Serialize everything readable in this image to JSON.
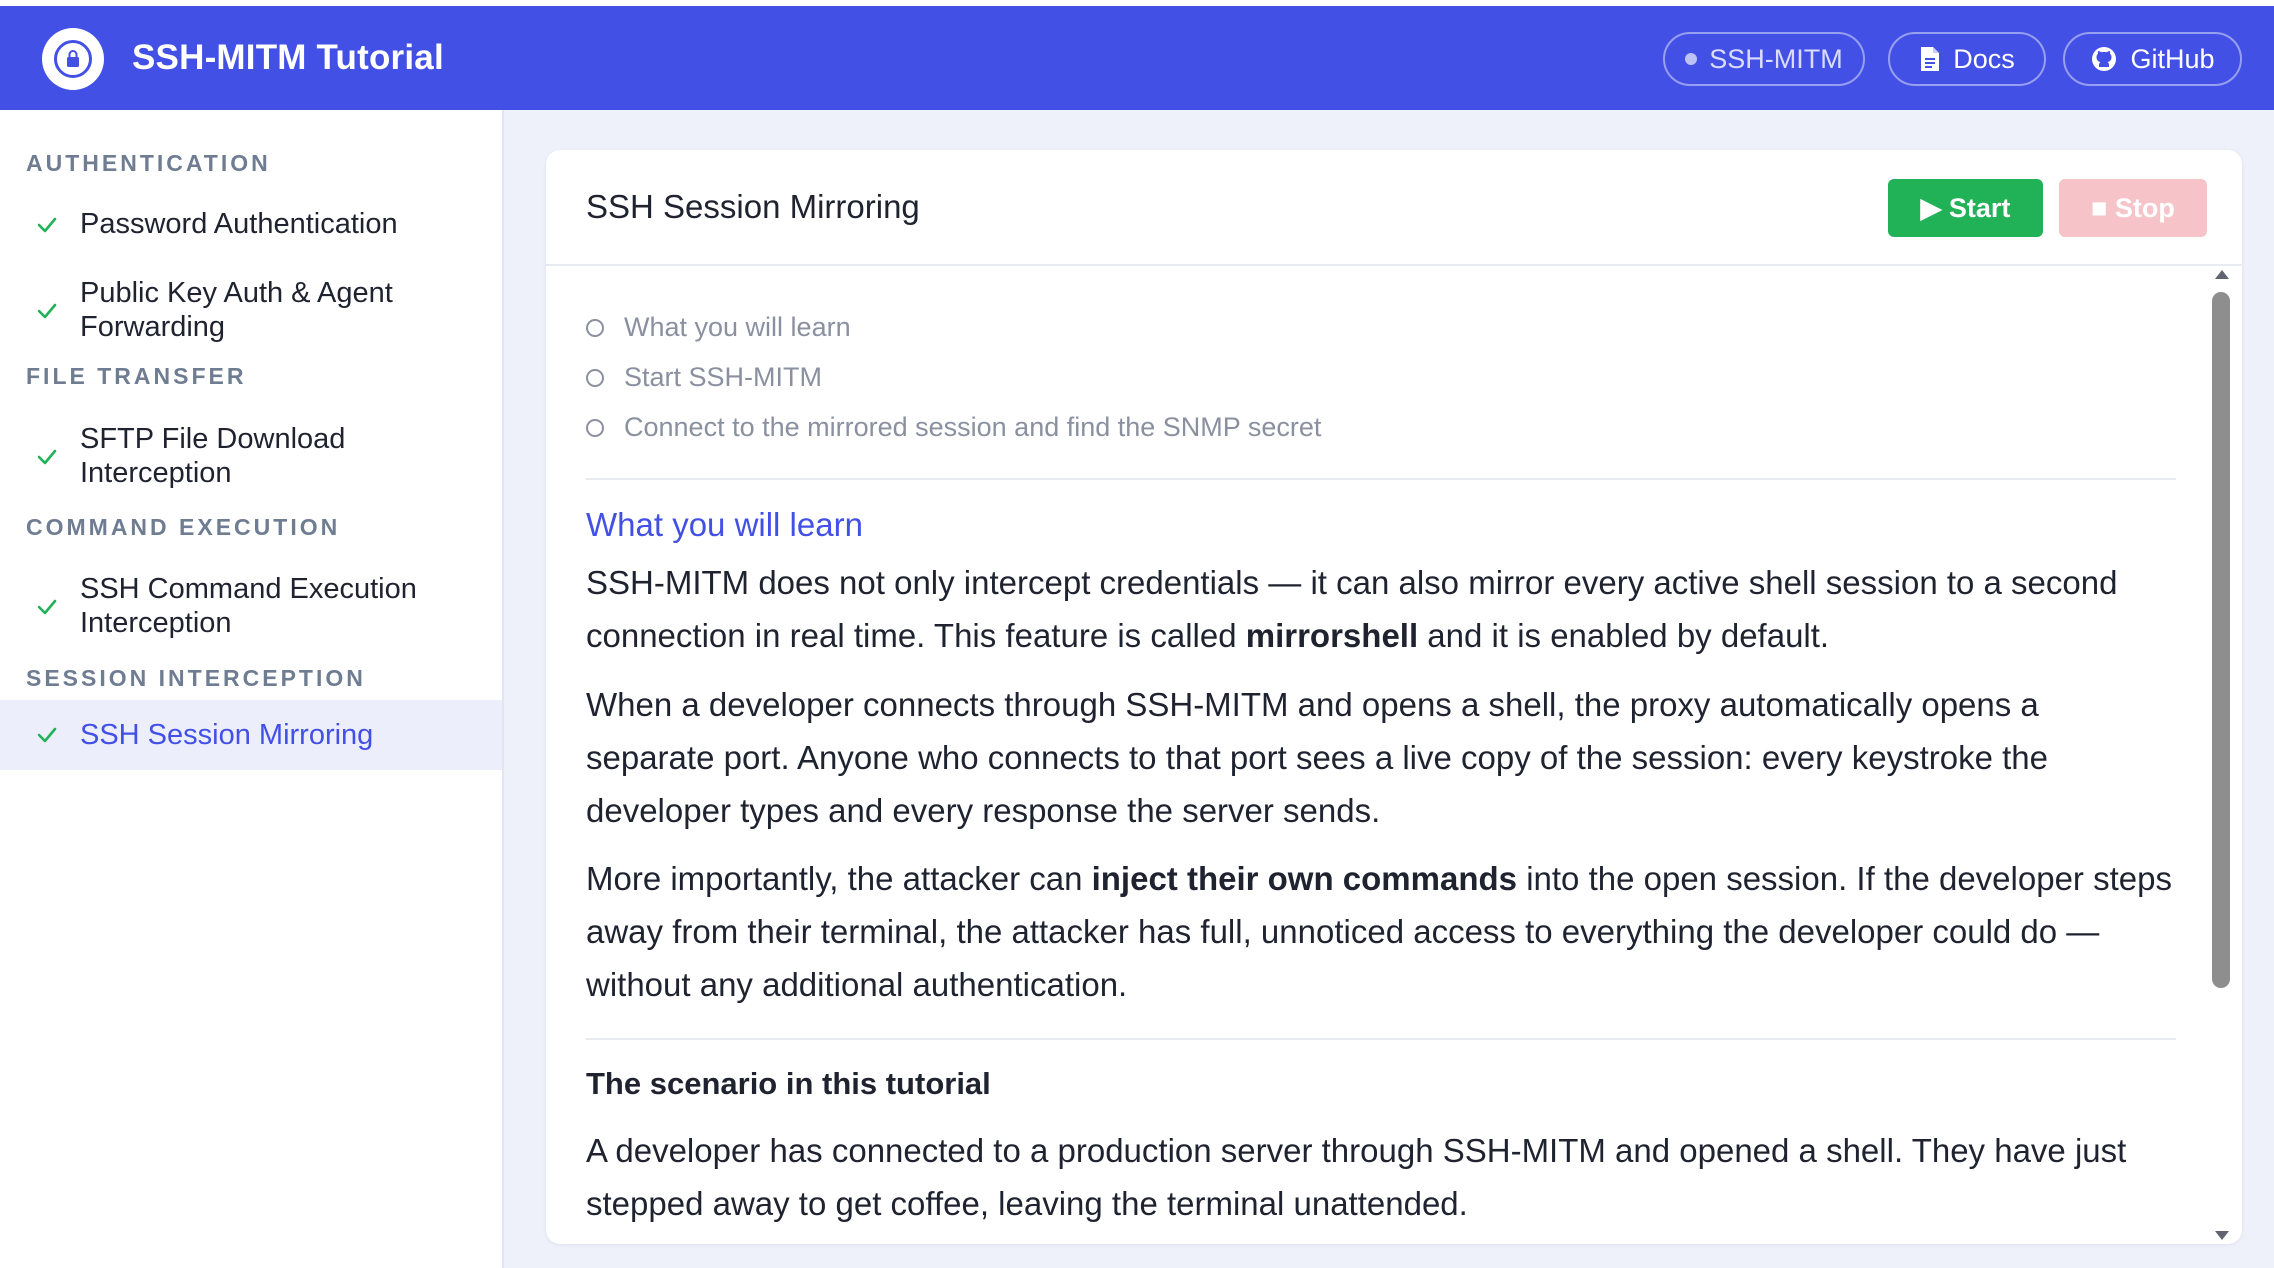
{
  "header": {
    "title": "SSH-MITM Tutorial",
    "status_label": "SSH-MITM",
    "docs_label": "Docs",
    "github_label": "GitHub",
    "color": "#4350e6"
  },
  "sidebar": {
    "sections": [
      {
        "title": "AUTHENTICATION",
        "items": [
          {
            "label": "Password Authentication",
            "done": true
          },
          {
            "label": "Public Key Auth & Agent",
            "label2": "Forwarding",
            "done": true
          }
        ]
      },
      {
        "title": "FILE TRANSFER",
        "items": [
          {
            "label": "SFTP File Download",
            "label2": "Interception",
            "done": true
          }
        ]
      },
      {
        "title": "COMMAND EXECUTION",
        "items": [
          {
            "label": "SSH Command Execution",
            "label2": "Interception",
            "done": true
          }
        ]
      },
      {
        "title": "SESSION INTERCEPTION",
        "items": [
          {
            "label": "SSH Session Mirroring",
            "done": true,
            "active": true
          }
        ]
      }
    ]
  },
  "card": {
    "title": "SSH Session Mirroring",
    "start_label": "▶ Start",
    "stop_label": "■ Stop",
    "toc": [
      "What you will learn",
      "Start SSH-MITM",
      "Connect to the mirrored session and find the SNMP secret"
    ],
    "section1_heading": "What you will learn",
    "p1_a": "SSH-MITM does not only intercept credentials — it can also mirror every active shell session to a second connection in real time. This feature is called ",
    "p1_bold": "mirrorshell",
    "p1_b": " and it is enabled by default.",
    "p2": "When a developer connects through SSH-MITM and opens a shell, the proxy automatically opens a separate port. Anyone who connects to that port sees a live copy of the session: every keystroke the developer types and every response the server sends.",
    "p3_a": "More importantly, the attacker can ",
    "p3_bold": "inject their own commands",
    "p3_b": " into the open session. If the developer steps away from their terminal, the attacker has full, unnoticed access to everything the developer could do — without any additional authentication.",
    "section2_heading": "The scenario in this tutorial",
    "p4": "A developer has connected to a production server through SSH-MITM and opened a shell. They have just stepped away to get coffee, leaving the terminal unattended."
  },
  "colors": {
    "accent": "#4350e6",
    "success": "#21b258",
    "stop_disabled": "#f6c3c9",
    "check": "#21b258"
  }
}
